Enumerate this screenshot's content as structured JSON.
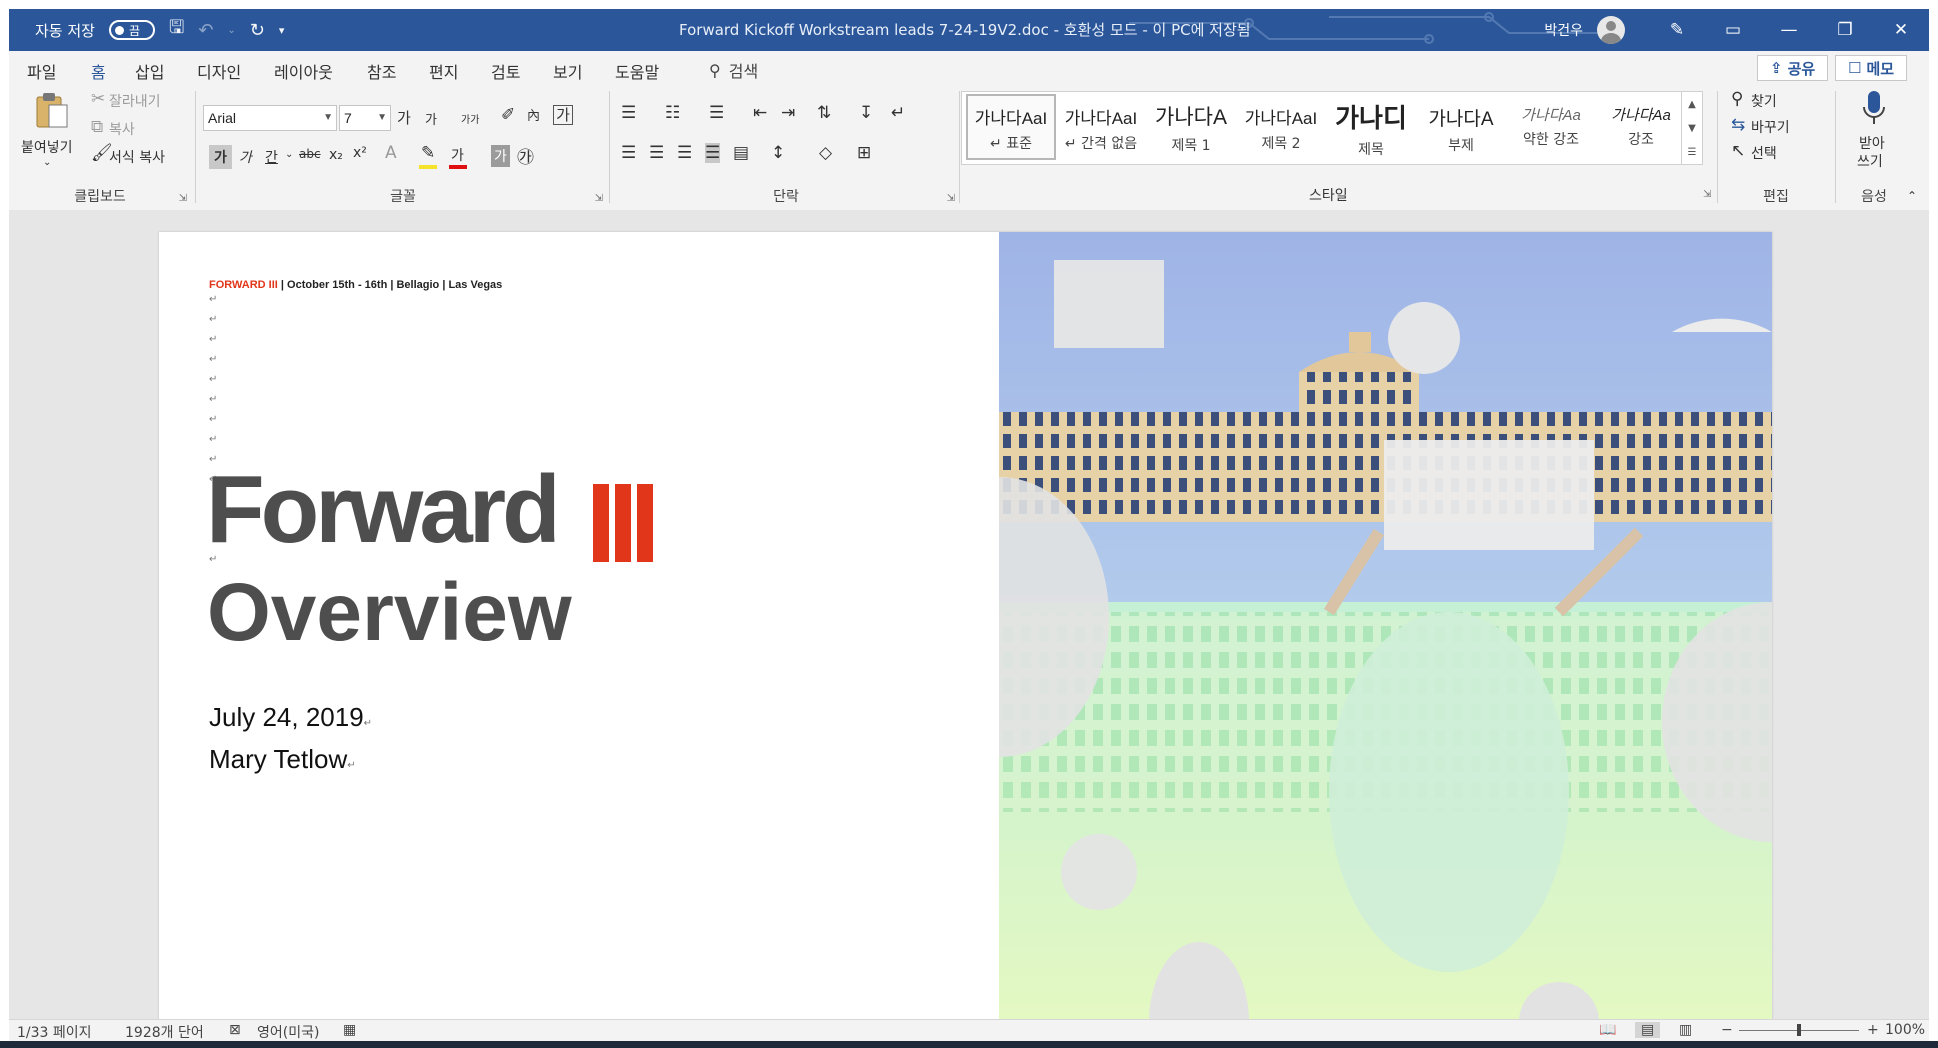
{
  "titlebar": {
    "autosave_label": "자동 저장",
    "autosave_state": "끔",
    "document_title": "Forward Kickoff Workstream leads 7-24-19V2.doc  -  호환성 모드  -  이 PC에 저장됨",
    "user_name": "박건우",
    "accent": "#2b579a"
  },
  "menu": {
    "tabs": [
      "파일",
      "홈",
      "삽입",
      "디자인",
      "레이아웃",
      "참조",
      "편지",
      "검토",
      "보기",
      "도움말"
    ],
    "active_tab": "홈",
    "search_label": "검색",
    "share_label": "공유",
    "comments_label": "메모"
  },
  "ribbon": {
    "clipboard": {
      "paste": "붙여넣기",
      "cut": "잘라내기",
      "copy": "복사",
      "format_painter": "서식 복사",
      "label": "클립보드"
    },
    "font": {
      "font_name": "Arial",
      "font_size": "7",
      "grow": "가",
      "shrink": "가",
      "case": "가가",
      "bold": "가",
      "italic": "가",
      "underline": "간",
      "font_color_glyph": "가",
      "char_shade_glyph": "가",
      "label": "글꼴"
    },
    "paragraph": {
      "label": "단락"
    },
    "styles": {
      "items": [
        {
          "preview": "가나다AaI",
          "name": "↵ 표준"
        },
        {
          "preview": "가나다AaI",
          "name": "↵ 간격 없음"
        },
        {
          "preview": "가나다A",
          "name": "제목 1"
        },
        {
          "preview": "가나다AaI",
          "name": "제목 2"
        },
        {
          "preview": "가나디",
          "name": "제목"
        },
        {
          "preview": "가나다A",
          "name": "부제"
        },
        {
          "preview": "가나다Aa",
          "name": "약한 강조"
        },
        {
          "preview": "가나다Aa",
          "name": "강조"
        }
      ],
      "label": "스타일"
    },
    "editing": {
      "find": "찾기",
      "replace": "바꾸기",
      "select": "선택",
      "label": "편집"
    },
    "voice": {
      "dictate_line1": "받아",
      "dictate_line2": "쓰기",
      "label": "음성"
    }
  },
  "document": {
    "header_brand": "FORWARD III",
    "header_rest": " | October 15th - 16th | Bellagio | Las Vegas",
    "big_title": "Forward",
    "subtitle": "Overview",
    "date": "July 24, 2019",
    "author": "Mary Tetlow",
    "brand_color": "#e2361b"
  },
  "statusbar": {
    "page": "1/33 페이지",
    "words": "1928개 단어",
    "language": "영어(미국)",
    "zoom": "100%"
  }
}
